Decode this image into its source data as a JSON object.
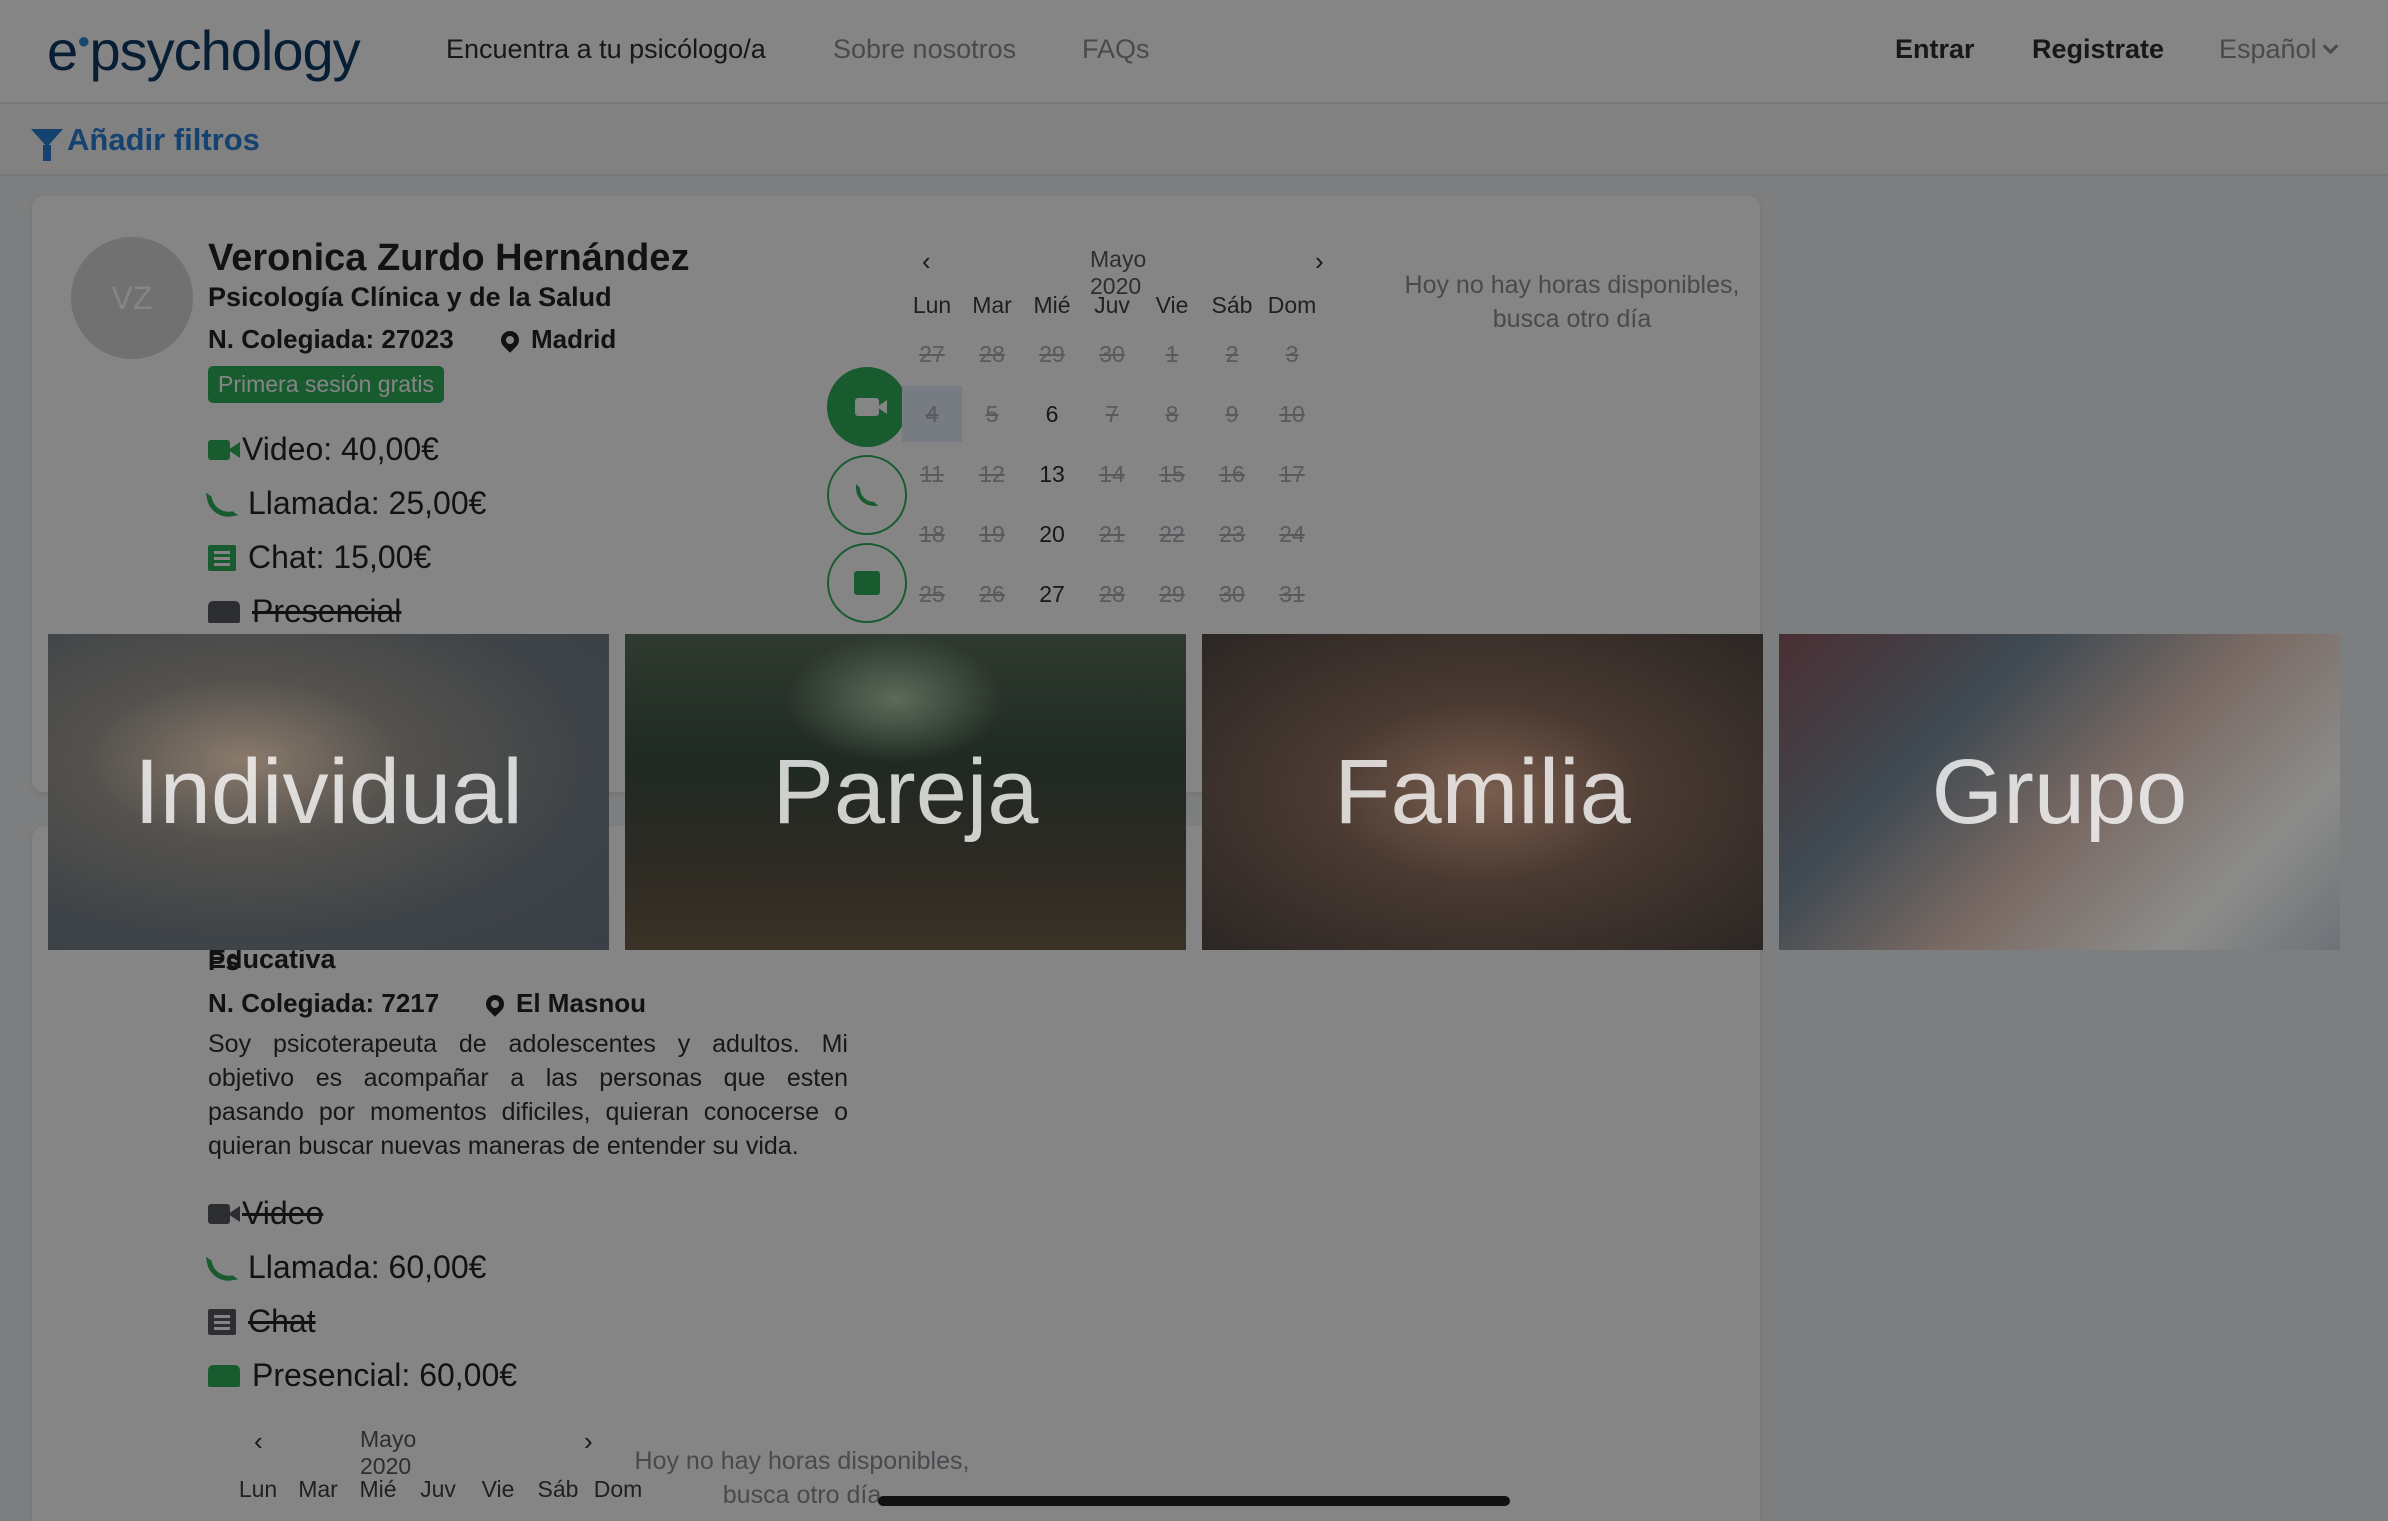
{
  "nav": {
    "logo_e": "e",
    "logo_rest": "psychology",
    "links": [
      "Encuentra a tu psicólogo/a",
      "Sobre nosotros",
      "FAQs"
    ],
    "login": "Entrar",
    "register": "Registrate",
    "language": "Español"
  },
  "filters": {
    "label": "Añadir filtros"
  },
  "card1": {
    "initials": "VZ",
    "name": "Veronica Zurdo Hernández",
    "specialty": "Psicología Clínica y de la Salud",
    "license": "N. Colegiada: 27023",
    "location": "Madrid",
    "badge": "Primera sesión gratis",
    "prices": {
      "video": "Video: 40,00€",
      "call": "Llamada: 25,00€",
      "chat": "Chat: 15,00€",
      "inperson": "Presencial"
    },
    "calendar": {
      "month": "Mayo 2020",
      "prev": "‹",
      "next": "›",
      "weekdays": [
        "Lun",
        "Mar",
        "Mié",
        "Juv",
        "Vie",
        "Sáb",
        "Dom"
      ],
      "weeks": [
        [
          "27",
          "28",
          "29",
          "30",
          "1",
          "2",
          "3"
        ],
        [
          "4",
          "5",
          "6",
          "7",
          "8",
          "9",
          "10"
        ],
        [
          "11",
          "12",
          "13",
          "14",
          "15",
          "16",
          "17"
        ],
        [
          "18",
          "19",
          "20",
          "21",
          "22",
          "23",
          "24"
        ],
        [
          "25",
          "26",
          "27",
          "28",
          "29",
          "30",
          "31"
        ]
      ],
      "available": [
        "6",
        "13",
        "20",
        "27"
      ],
      "selected": "4"
    },
    "no_hours_line1": "Hoy no hay horas disponibles,",
    "no_hours_line2": "busca otro día"
  },
  "card2": {
    "specialty_partial": "Educativa",
    "name_fragment": "Ps",
    "license": "N. Colegiada: 7217",
    "location": "El Masnou",
    "description": "Soy psicoterapeuta de adolescentes y adultos. Mi objetivo es acompañar a las personas que esten pasando por momentos dificiles, quieran conocerse o quieran buscar nuevas maneras de entender su vida.",
    "prices": {
      "video": "Video",
      "call": "Llamada: 60,00€",
      "chat": "Chat",
      "inperson": "Presencial: 60,00€"
    },
    "calendar": {
      "month": "Mayo 2020",
      "prev": "‹",
      "next": "›",
      "weekdays": [
        "Lun",
        "Mar",
        "Mié",
        "Juv",
        "Vie",
        "Sáb",
        "Dom"
      ]
    },
    "no_hours_line1": "Hoy no hay horas disponibles,",
    "no_hours_line2": "busca otro día"
  },
  "tiles": [
    "Individual",
    "Pareja",
    "Familia",
    "Grupo"
  ]
}
